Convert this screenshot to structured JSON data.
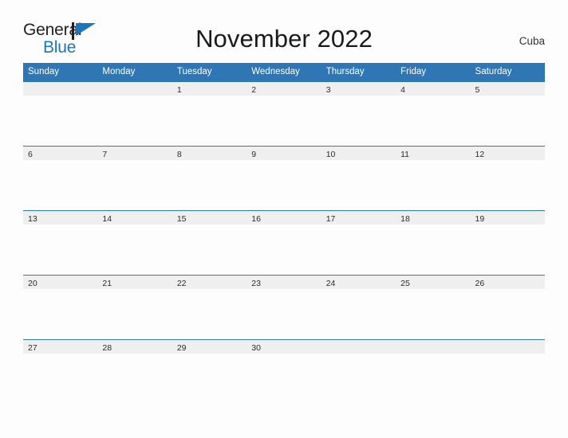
{
  "brand": {
    "name_part1": "General",
    "name_part2": "Blue",
    "flag_icon": "blue-triangle-flag-icon",
    "colors": {
      "text_dark": "#231f20",
      "text_blue": "#1b76bc",
      "flag_blue": "#1b76bc"
    }
  },
  "header": {
    "title": "November 2022",
    "locale": "Cuba"
  },
  "calendar": {
    "month": "November",
    "year": "2022",
    "accent_color": "#2e76b4",
    "date_strip_color": "#efefef",
    "weekdays": [
      "Sunday",
      "Monday",
      "Tuesday",
      "Wednesday",
      "Thursday",
      "Friday",
      "Saturday"
    ],
    "weeks": [
      [
        "",
        "",
        "1",
        "2",
        "3",
        "4",
        "5"
      ],
      [
        "6",
        "7",
        "8",
        "9",
        "10",
        "11",
        "12"
      ],
      [
        "13",
        "14",
        "15",
        "16",
        "17",
        "18",
        "19"
      ],
      [
        "20",
        "21",
        "22",
        "23",
        "24",
        "25",
        "26"
      ],
      [
        "27",
        "28",
        "29",
        "30",
        "",
        "",
        ""
      ]
    ]
  }
}
